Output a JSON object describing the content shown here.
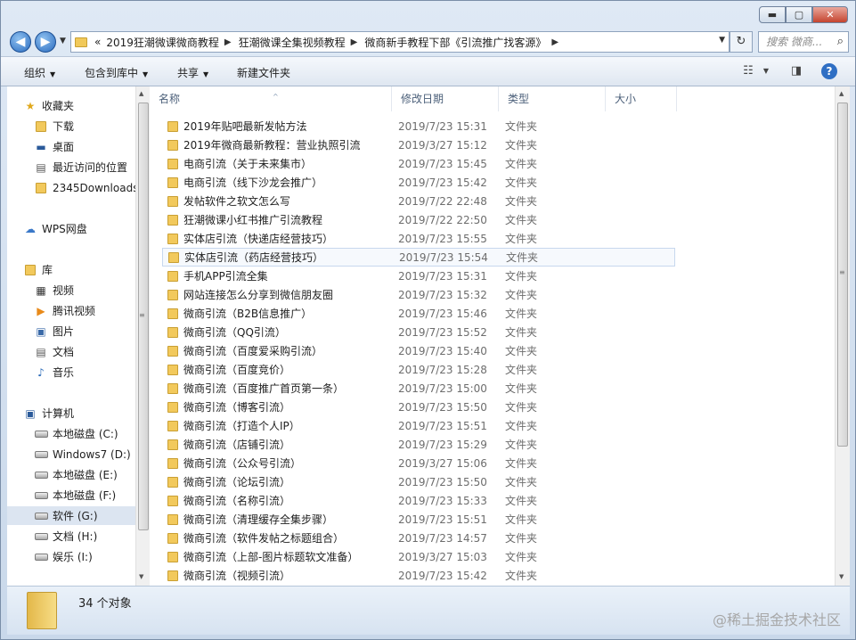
{
  "window": {
    "controls": {
      "minimize": "▬",
      "maximize": "▢",
      "close": "✕"
    }
  },
  "navigation": {
    "back_icon": "◀",
    "forward_icon": "▶",
    "address_prefix": "«",
    "breadcrumbs": [
      "2019狂潮微课微商教程",
      "狂潮微课全集视频教程",
      "微商新手教程下部《引流推广找客源》"
    ],
    "search_placeholder": "搜索 微商...",
    "search_icon": "⌕",
    "refresh_icon": "↻"
  },
  "toolbar": {
    "organize": "组织",
    "include_in_library": "包含到库中",
    "share": "共享",
    "new_folder": "新建文件夹"
  },
  "sidebar": {
    "favorites": {
      "label": "收藏夹",
      "items": [
        "下载",
        "桌面",
        "最近访问的位置",
        "2345Downloads"
      ]
    },
    "wps": "WPS网盘",
    "library": {
      "label": "库",
      "items": [
        "视频",
        "腾讯视频",
        "图片",
        "文档",
        "音乐"
      ]
    },
    "computer": {
      "label": "计算机",
      "items": [
        "本地磁盘 (C:)",
        "Windows7 (D:)",
        "本地磁盘 (E:)",
        "本地磁盘 (F:)",
        "软件 (G:)",
        "文档 (H:)",
        "娱乐 (I:)"
      ]
    }
  },
  "columns": {
    "name": "名称",
    "date": "修改日期",
    "type": "类型",
    "size": "大小"
  },
  "files": [
    {
      "name": "2019年贴吧最新发帖方法",
      "date": "2019/7/23 15:31",
      "type": "文件夹"
    },
    {
      "name": "2019年微商最新教程：营业执照引流",
      "date": "2019/3/27 15:12",
      "type": "文件夹"
    },
    {
      "name": "电商引流（关于未来集市）",
      "date": "2019/7/23 15:45",
      "type": "文件夹"
    },
    {
      "name": "电商引流（线下沙龙会推广）",
      "date": "2019/7/23 15:42",
      "type": "文件夹"
    },
    {
      "name": "发帖软件之软文怎么写",
      "date": "2019/7/22 22:48",
      "type": "文件夹"
    },
    {
      "name": "狂潮微课小红书推广引流教程",
      "date": "2019/7/22 22:50",
      "type": "文件夹"
    },
    {
      "name": "实体店引流（快递店经营技巧）",
      "date": "2019/7/23 15:55",
      "type": "文件夹"
    },
    {
      "name": "实体店引流（药店经营技巧）",
      "date": "2019/7/23 15:54",
      "type": "文件夹"
    },
    {
      "name": "手机APP引流全集",
      "date": "2019/7/23 15:31",
      "type": "文件夹"
    },
    {
      "name": "网站连接怎么分享到微信朋友圈",
      "date": "2019/7/23 15:32",
      "type": "文件夹"
    },
    {
      "name": "微商引流（B2B信息推广）",
      "date": "2019/7/23 15:46",
      "type": "文件夹"
    },
    {
      "name": "微商引流（QQ引流）",
      "date": "2019/7/23 15:52",
      "type": "文件夹"
    },
    {
      "name": "微商引流（百度爱采购引流）",
      "date": "2019/7/23 15:40",
      "type": "文件夹"
    },
    {
      "name": "微商引流（百度竞价）",
      "date": "2019/7/23 15:28",
      "type": "文件夹"
    },
    {
      "name": "微商引流（百度推广首页第一条）",
      "date": "2019/7/23 15:00",
      "type": "文件夹"
    },
    {
      "name": "微商引流（博客引流）",
      "date": "2019/7/23 15:50",
      "type": "文件夹"
    },
    {
      "name": "微商引流（打造个人IP）",
      "date": "2019/7/23 15:51",
      "type": "文件夹"
    },
    {
      "name": "微商引流（店铺引流）",
      "date": "2019/7/23 15:29",
      "type": "文件夹"
    },
    {
      "name": "微商引流（公众号引流）",
      "date": "2019/3/27 15:06",
      "type": "文件夹"
    },
    {
      "name": "微商引流（论坛引流）",
      "date": "2019/7/23 15:50",
      "type": "文件夹"
    },
    {
      "name": "微商引流（名称引流）",
      "date": "2019/7/23 15:33",
      "type": "文件夹"
    },
    {
      "name": "微商引流（清理缓存全集步骤）",
      "date": "2019/7/23 15:51",
      "type": "文件夹"
    },
    {
      "name": "微商引流（软件发帖之标题组合）",
      "date": "2019/7/23 14:57",
      "type": "文件夹"
    },
    {
      "name": "微商引流（上部-图片标题软文准备）",
      "date": "2019/3/27 15:03",
      "type": "文件夹"
    },
    {
      "name": "微商引流（视频引流）",
      "date": "2019/7/23 15:42",
      "type": "文件夹"
    }
  ],
  "status": {
    "count": "34 个对象"
  },
  "watermark": "@稀土掘金技术社区"
}
